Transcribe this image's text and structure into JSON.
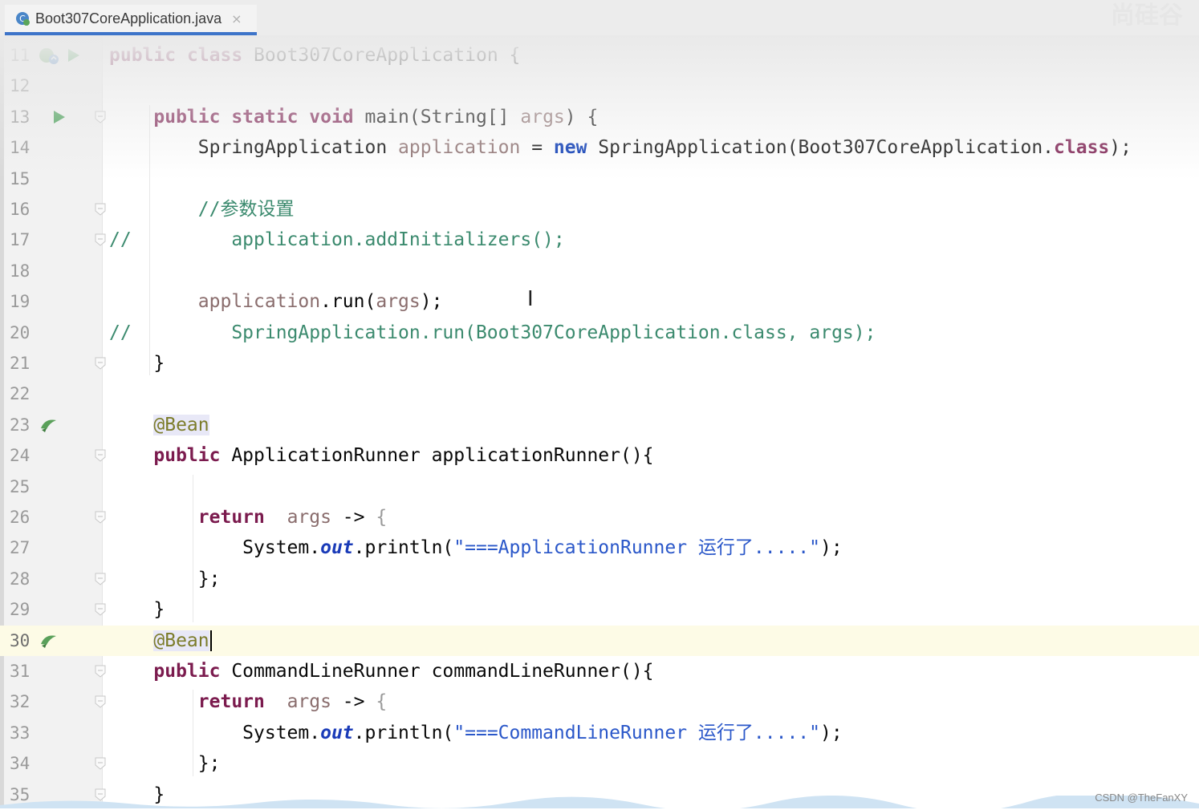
{
  "tab": {
    "label": "Boot307CoreApplication.java",
    "close": "×"
  },
  "watermark": "尚硅谷",
  "footer_credit": "CSDN @TheFanXY",
  "lines": [
    {
      "n": "11",
      "segs": [
        [
          "kw2",
          "public "
        ],
        [
          "kw2",
          "class "
        ],
        [
          "",
          "Boot307CoreApplication {"
        ]
      ]
    },
    {
      "n": "12",
      "segs": []
    },
    {
      "n": "13",
      "segs": [
        [
          "",
          "    "
        ],
        [
          "kw2",
          "public "
        ],
        [
          "kw2",
          "static "
        ],
        [
          "kw2",
          "void "
        ],
        [
          "",
          "main(String[] "
        ],
        [
          "var",
          "args"
        ],
        [
          "",
          ") {"
        ]
      ]
    },
    {
      "n": "14",
      "segs": [
        [
          "",
          "        SpringApplication "
        ],
        [
          "var",
          "application"
        ],
        [
          "",
          " = "
        ],
        [
          "kw",
          "new "
        ],
        [
          "",
          "SpringApplication(Boot307CoreApplication."
        ],
        [
          "kw2",
          "class"
        ],
        [
          "",
          ");"
        ]
      ]
    },
    {
      "n": "15",
      "segs": []
    },
    {
      "n": "16",
      "segs": [
        [
          "",
          "        "
        ],
        [
          "cm",
          "//参数设置"
        ]
      ]
    },
    {
      "n": "17",
      "segs": [
        [
          "cm",
          "//         application.addInitializers();"
        ]
      ]
    },
    {
      "n": "18",
      "segs": []
    },
    {
      "n": "19",
      "segs": [
        [
          "",
          "        "
        ],
        [
          "var",
          "application"
        ],
        [
          "",
          ".run("
        ],
        [
          "var",
          "args"
        ],
        [
          "",
          ");"
        ]
      ]
    },
    {
      "n": "20",
      "segs": [
        [
          "cm",
          "//         SpringApplication.run(Boot307CoreApplication.class, args);"
        ]
      ]
    },
    {
      "n": "21",
      "segs": [
        [
          "",
          "    }"
        ]
      ]
    },
    {
      "n": "22",
      "segs": []
    },
    {
      "n": "23",
      "segs": [
        [
          "",
          "    "
        ],
        [
          "ann annbg",
          "@Bean"
        ]
      ]
    },
    {
      "n": "24",
      "segs": [
        [
          "",
          "    "
        ],
        [
          "kw2",
          "public "
        ],
        [
          "",
          "ApplicationRunner applicationRunner(){"
        ]
      ]
    },
    {
      "n": "25",
      "segs": []
    },
    {
      "n": "26",
      "segs": [
        [
          "",
          "        "
        ],
        [
          "kw2",
          "return  "
        ],
        [
          "var",
          "args"
        ],
        [
          "",
          " -> "
        ],
        [
          "lam",
          "{"
        ]
      ]
    },
    {
      "n": "27",
      "segs": [
        [
          "",
          "            System."
        ],
        [
          "fld",
          "out"
        ],
        [
          "",
          ".println("
        ],
        [
          "str",
          "\"===ApplicationRunner 运行了.....\""
        ],
        [
          "",
          ");"
        ]
      ]
    },
    {
      "n": "28",
      "segs": [
        [
          "",
          "        };"
        ]
      ]
    },
    {
      "n": "29",
      "segs": [
        [
          "",
          "    }"
        ]
      ]
    },
    {
      "n": "30",
      "segs": [
        [
          "",
          "    "
        ],
        [
          "ann annbg",
          "@Bean"
        ]
      ],
      "current": true
    },
    {
      "n": "31",
      "segs": [
        [
          "",
          "    "
        ],
        [
          "kw2",
          "public "
        ],
        [
          "",
          "CommandLineRunner commandLineRunner(){"
        ]
      ]
    },
    {
      "n": "32",
      "segs": [
        [
          "",
          "        "
        ],
        [
          "kw2",
          "return  "
        ],
        [
          "var",
          "args"
        ],
        [
          "",
          " -> "
        ],
        [
          "lam",
          "{"
        ]
      ]
    },
    {
      "n": "33",
      "segs": [
        [
          "",
          "            System."
        ],
        [
          "fld",
          "out"
        ],
        [
          "",
          ".println("
        ],
        [
          "str",
          "\"===CommandLineRunner 运行了.....\""
        ],
        [
          "",
          ");"
        ]
      ]
    },
    {
      "n": "34",
      "segs": [
        [
          "",
          "        };"
        ]
      ]
    },
    {
      "n": "35",
      "segs": [
        [
          "",
          "    }"
        ]
      ]
    }
  ],
  "gutter_icons": {
    "11": [
      "spring-bean-icon",
      "run-icon"
    ],
    "13": [
      "run-icon"
    ],
    "23": [
      "bean-icon"
    ],
    "30": [
      "bean-icon"
    ]
  },
  "folds": [
    "13",
    "16",
    "17",
    "21",
    "24",
    "26",
    "28",
    "29",
    "31",
    "32",
    "34",
    "35"
  ],
  "colors": {
    "keyword": "#7b1b4e",
    "comment": "#3b8a6e",
    "string": "#2a57c9",
    "current_line": "#fdfbe6",
    "tab_underline": "#3d74c9"
  }
}
